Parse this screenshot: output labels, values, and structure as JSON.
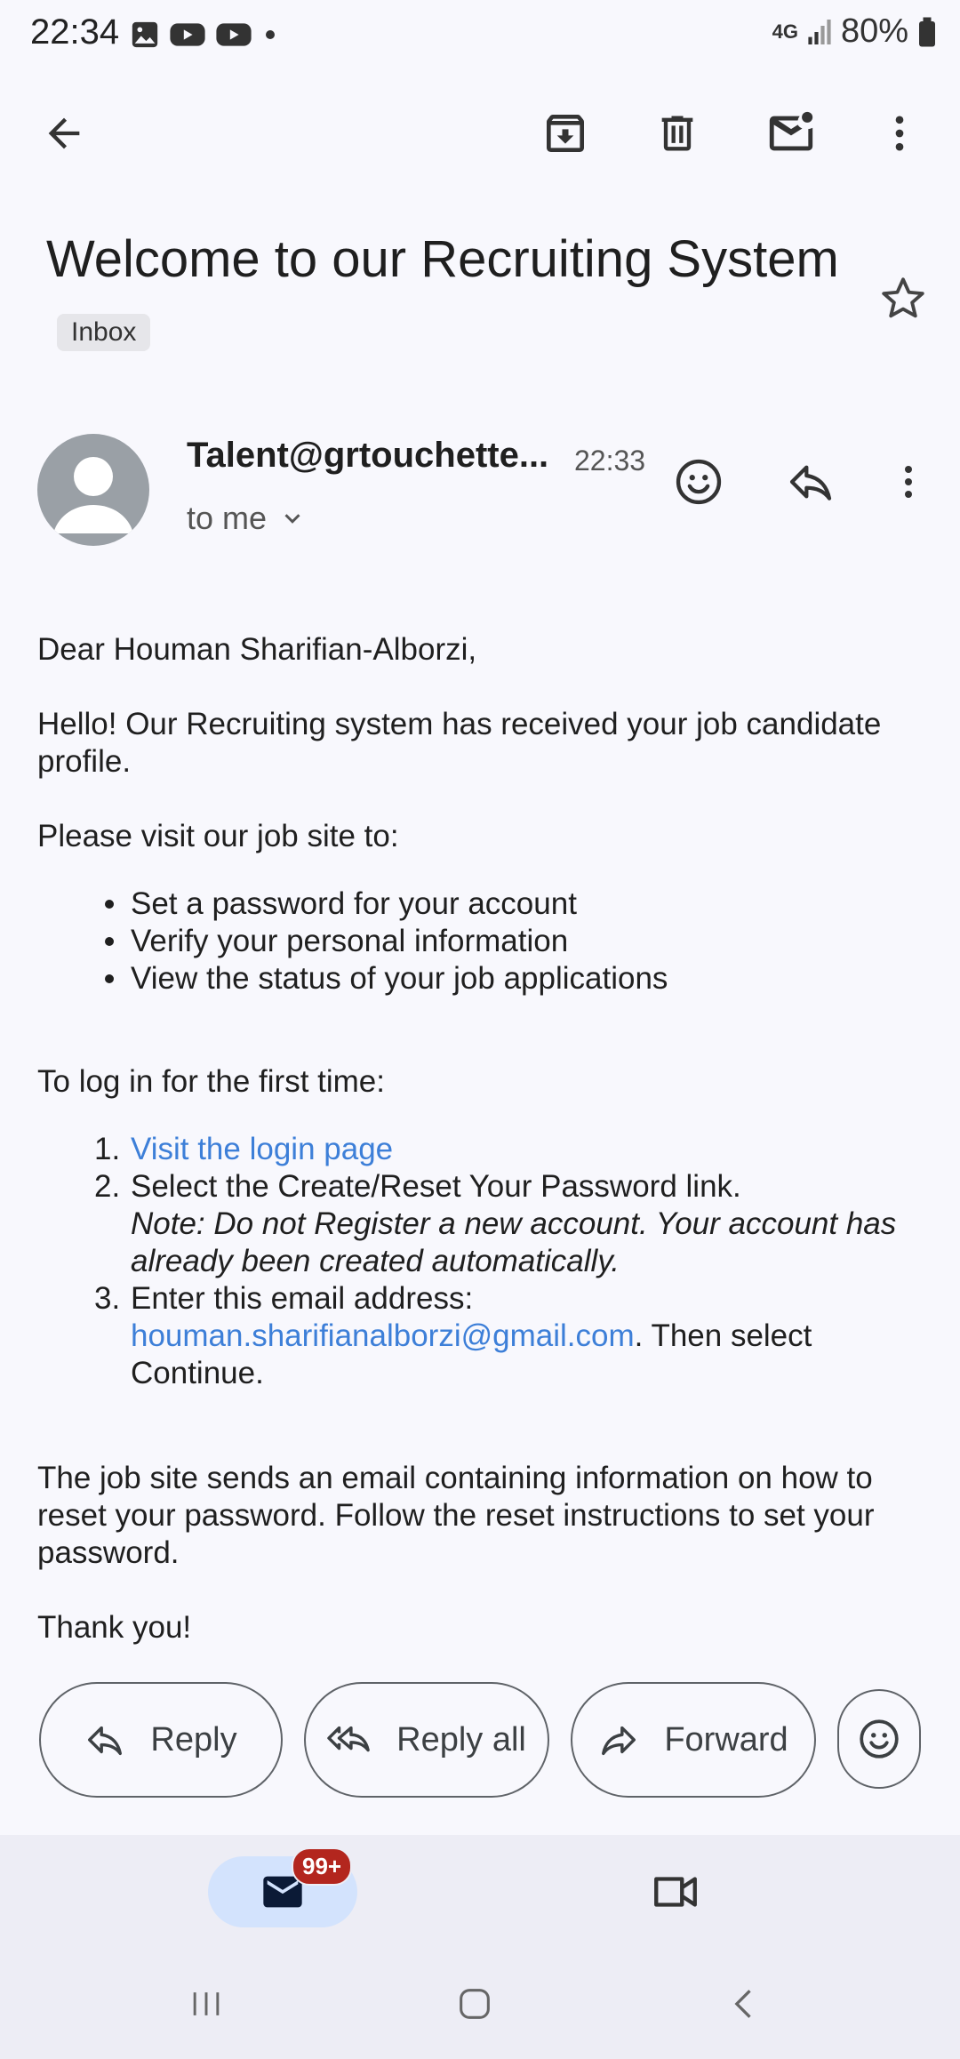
{
  "status_bar": {
    "time": "22:34",
    "network": "4G",
    "battery": "80%"
  },
  "toolbar": {
    "back_icon": "arrow-back-icon",
    "archive_icon": "archive-icon",
    "delete_icon": "trash-icon",
    "unread_icon": "mark-unread-icon",
    "more_icon": "more-vert-icon"
  },
  "email": {
    "subject": "Welcome to our Recruiting System",
    "label": "Inbox",
    "sender": "Talent@grtouchette...",
    "time": "22:33",
    "recipient": "to me",
    "greeting": "Dear Houman Sharifian-Alborzi,",
    "intro": "Hello! Our Recruiting system has received your job candidate profile.",
    "visit_heading": "Please visit our job site to:",
    "visit_items": [
      "Set a password for your account",
      "Verify your personal information",
      "View the status of your job applications"
    ],
    "login_heading": "To log in for the first time:",
    "steps": {
      "s1_link": "Visit the login page",
      "s2_text": "Select the Create/Reset Your Password link.",
      "s2_note": "Note: Do not Register a new account. Your account has already been created automatically.",
      "s3_text": "Enter this email address:",
      "s3_email": "houman.sharifianalborzi@gmail.com",
      "s3_suffix": ". Then select Continue."
    },
    "reset_info": "The job site sends an email containing information on how to reset your password. Follow the reset instructions to set your password.",
    "closing": "Thank you!"
  },
  "actions": {
    "reply": "Reply",
    "reply_all": "Reply all",
    "forward": "Forward"
  },
  "bottom_nav": {
    "mail_badge": "99+"
  },
  "colors": {
    "link": "#3d7fd8",
    "badge": "#b3261e",
    "selected_pill": "#d3e3fd"
  }
}
